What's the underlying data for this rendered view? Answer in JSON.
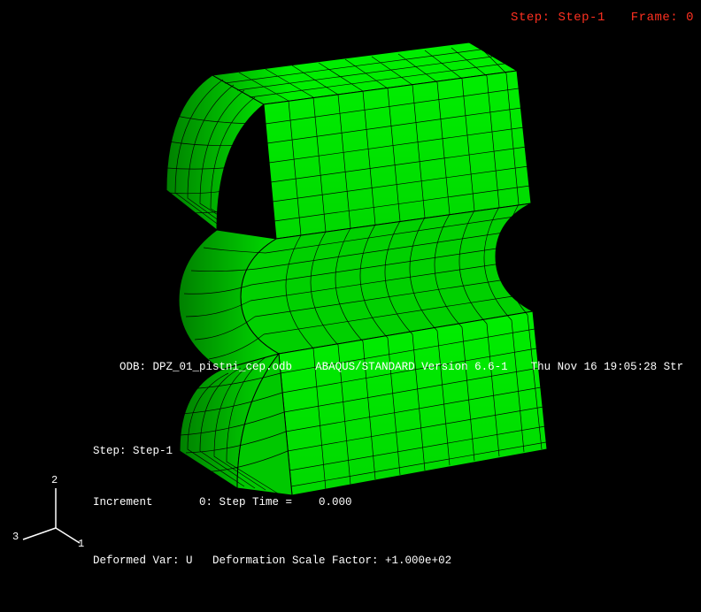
{
  "top_status": {
    "step_label": "Step: Step-1",
    "frame_label": "Frame: 0"
  },
  "odb_line": {
    "odb": "ODB: DPZ_01_pistni_cep.odb",
    "version": "ABAQUS/STANDARD Version 6.6-1",
    "timestamp": "Thu Nov 16 19:05:28 Str"
  },
  "step_block": {
    "step": "Step: Step-1",
    "increment": "Increment       0: Step Time =    0.000",
    "deformed": "Deformed Var: U   Deformation Scale Factor: +1.000e+02"
  },
  "triad": {
    "axis_a": "2",
    "axis_b": "3",
    "axis_c": "1"
  },
  "mesh": {
    "color": "#00ee00",
    "edge_color": "#000000"
  }
}
